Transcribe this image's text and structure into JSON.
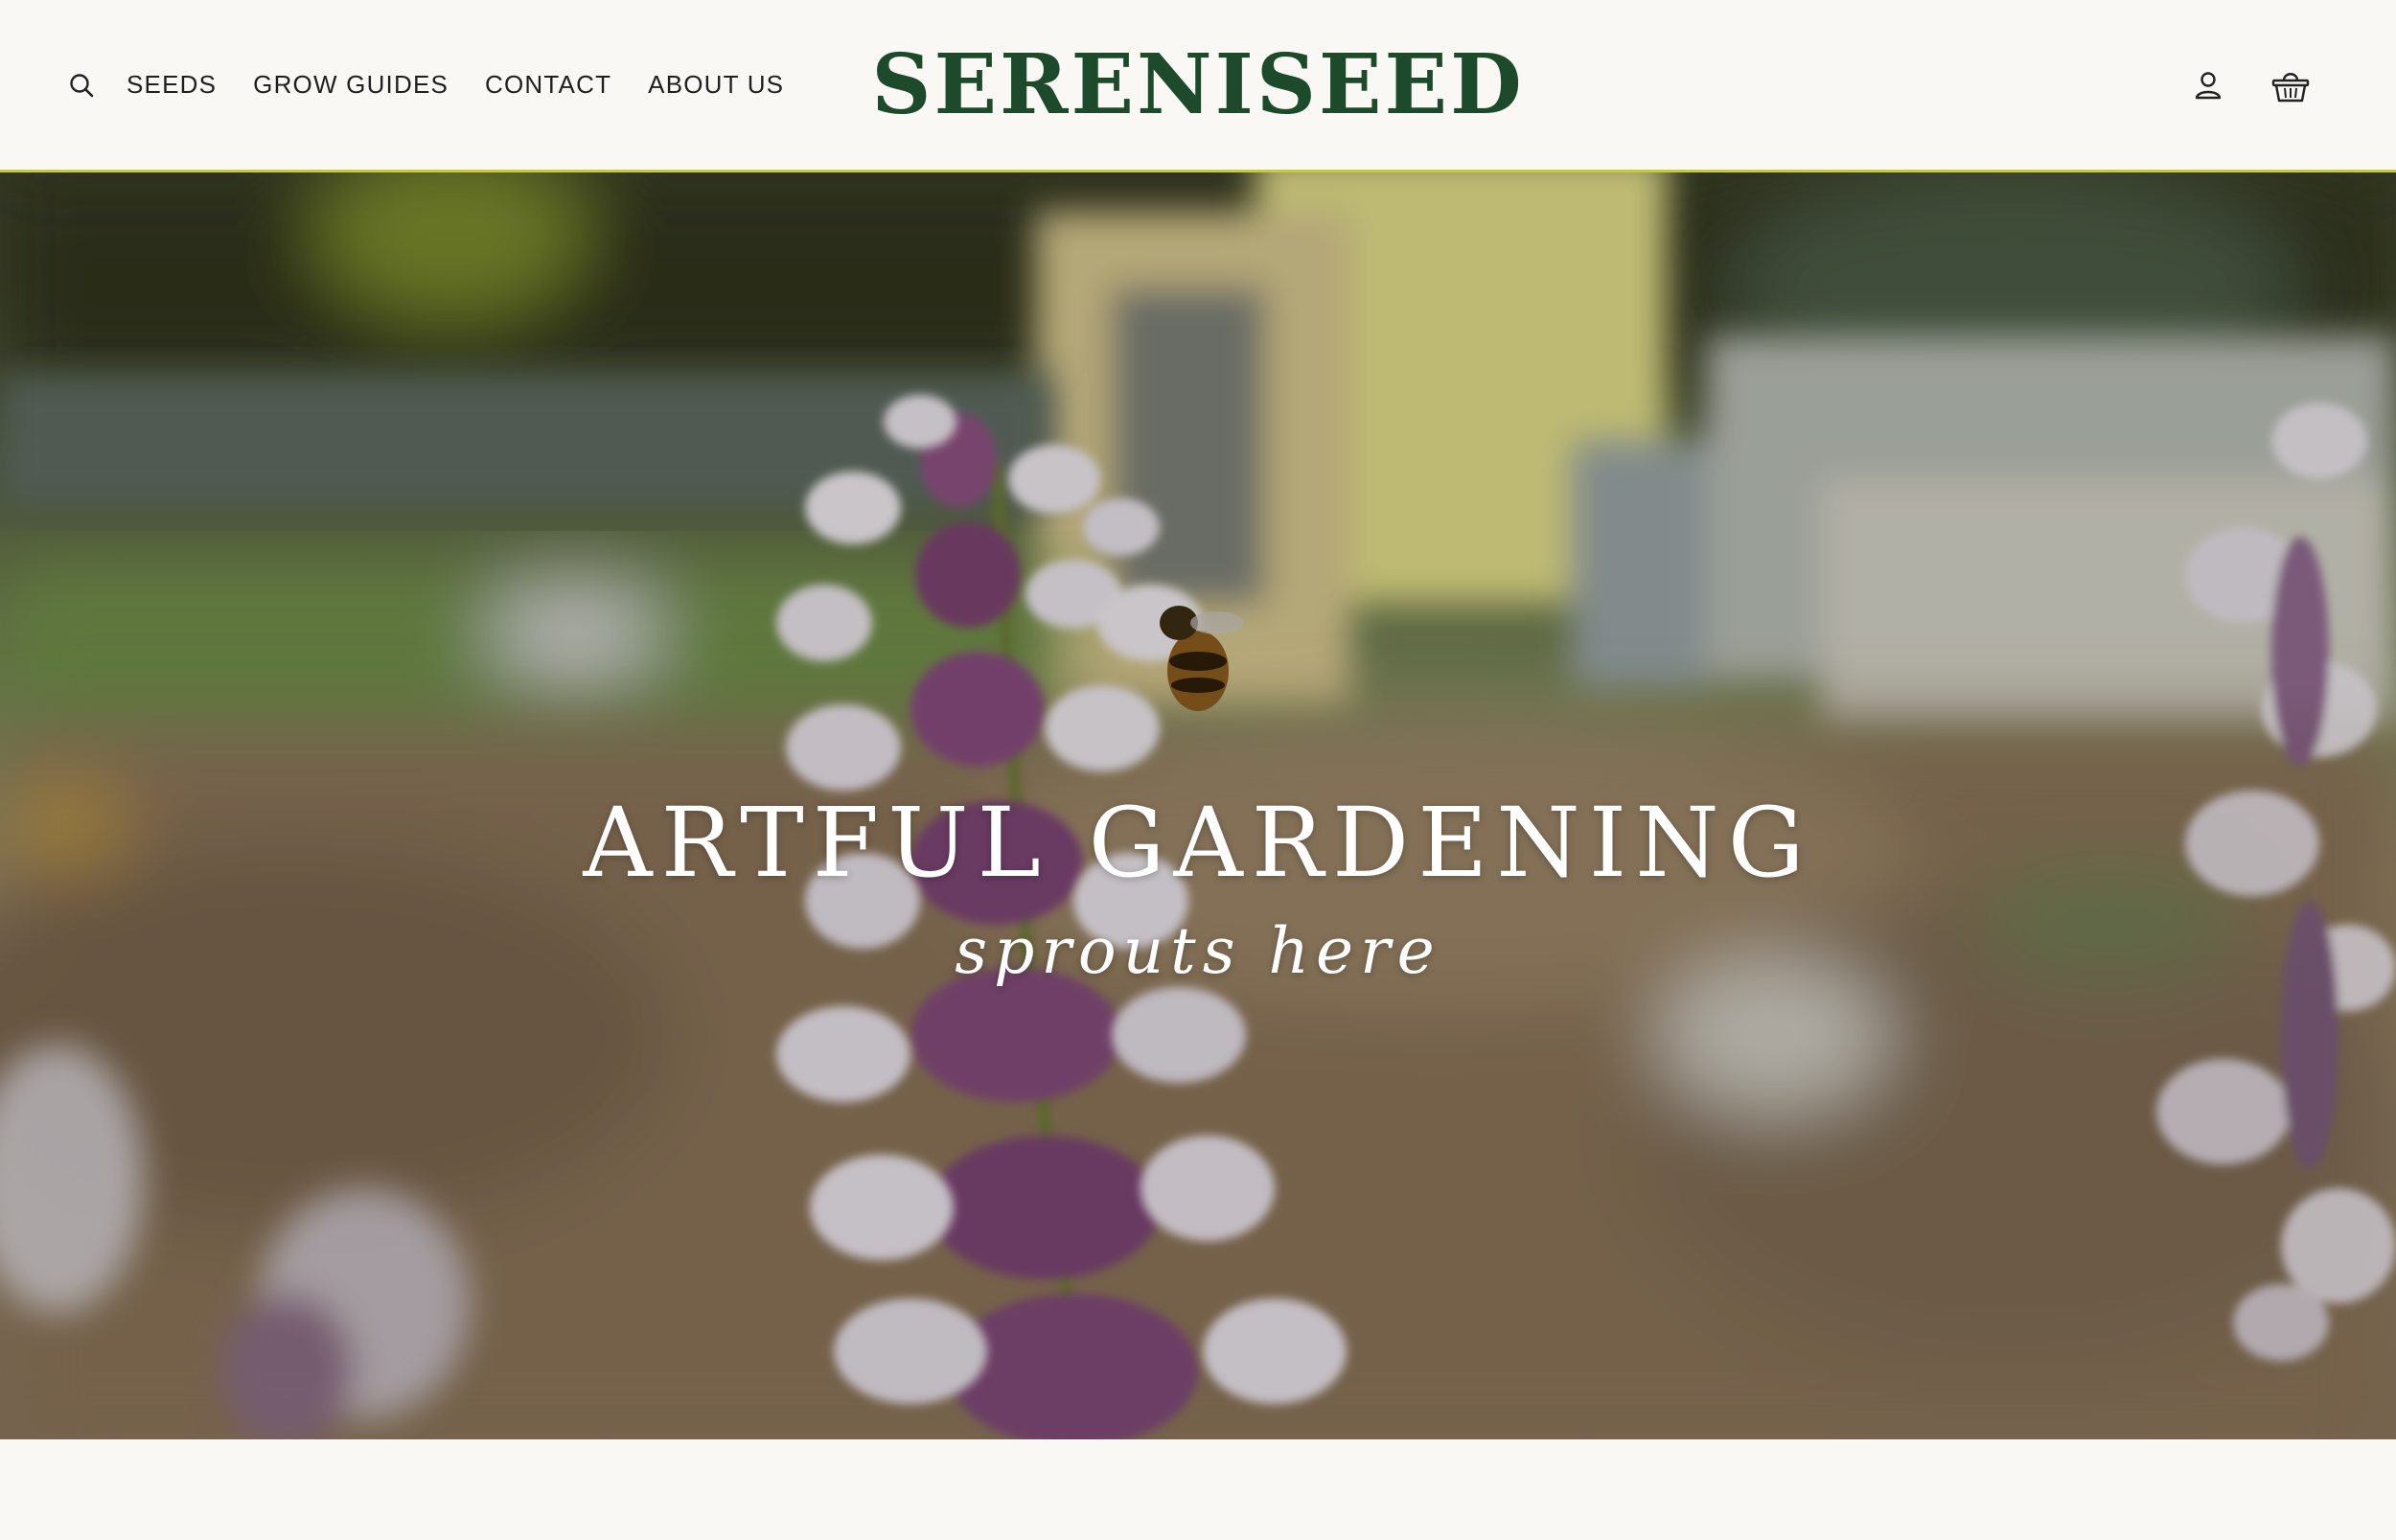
{
  "brand": {
    "logo_text": "SERENISEED",
    "logo_color": "#1e4a2c",
    "accent_border": "#c6c93a"
  },
  "header": {
    "search_icon": "search-icon",
    "nav": [
      {
        "label": "SEEDS"
      },
      {
        "label": "GROW GUIDES"
      },
      {
        "label": "CONTACT"
      },
      {
        "label": "ABOUT US"
      }
    ],
    "account_icon": "user-icon",
    "cart_icon": "basket-icon"
  },
  "hero": {
    "title": "ARTFUL GARDENING",
    "subtitle": "sprouts here"
  }
}
